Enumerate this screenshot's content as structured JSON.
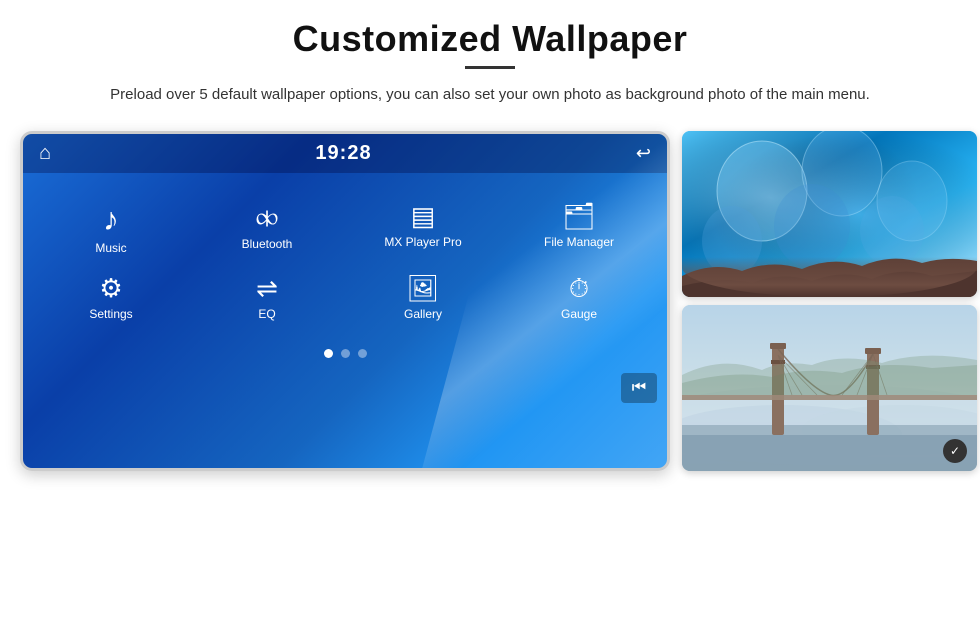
{
  "page": {
    "title": "Customized Wallpaper",
    "subtitle": "Preload over 5 default wallpaper options, you can also set your own photo as background photo of the main menu."
  },
  "divider": {
    "visible": true
  },
  "car_screen": {
    "time": "19:28",
    "icons": [
      {
        "label": "Music",
        "symbol": "♪"
      },
      {
        "label": "Bluetooth",
        "symbol": "⑁"
      },
      {
        "label": "MX Player Pro",
        "symbol": "▤"
      },
      {
        "label": "File Manager",
        "symbol": "📁"
      },
      {
        "label": "Settings",
        "symbol": "⚙"
      },
      {
        "label": "EQ",
        "symbol": "⇌"
      },
      {
        "label": "Gallery",
        "symbol": "🖼"
      },
      {
        "label": "Gauge",
        "symbol": "⏱"
      }
    ],
    "dots": [
      {
        "active": true
      },
      {
        "active": false
      },
      {
        "active": false
      }
    ]
  },
  "thumbnails": [
    {
      "id": "ice-cave",
      "alt": "Ice cave background"
    },
    {
      "id": "bridge-fog",
      "alt": "Golden Gate Bridge in fog"
    }
  ]
}
